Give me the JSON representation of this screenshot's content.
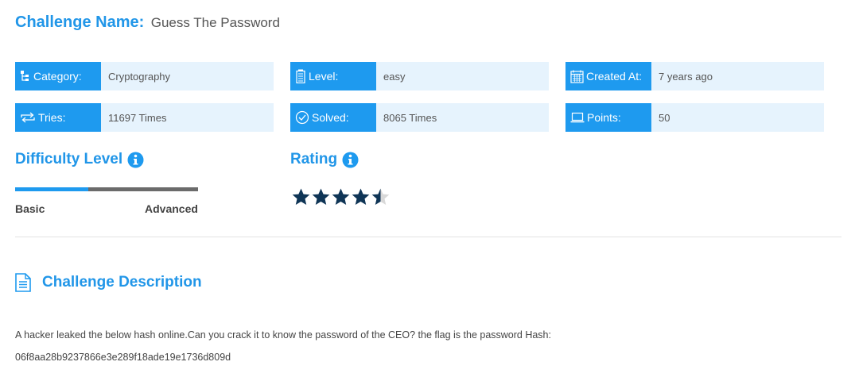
{
  "challenge": {
    "name_label": "Challenge Name:",
    "name": "Guess The Password"
  },
  "info": {
    "category": {
      "label": "Category:",
      "value": "Cryptography",
      "icon": "tree-icon"
    },
    "level": {
      "label": "Level:",
      "value": "easy",
      "icon": "battery-icon"
    },
    "created": {
      "label": "Created At:",
      "value": "7 years ago",
      "icon": "calendar-icon"
    },
    "tries": {
      "label": "Tries:",
      "value": "11697 Times",
      "icon": "repeat-icon"
    },
    "solved": {
      "label": "Solved:",
      "value": "8065 Times",
      "icon": "check-circle-icon"
    },
    "points": {
      "label": "Points:",
      "value": "50",
      "icon": "laptop-icon"
    }
  },
  "difficulty": {
    "title": "Difficulty Level",
    "level_fraction": 0.4,
    "min_label": "Basic",
    "max_label": "Advanced"
  },
  "rating": {
    "title": "Rating",
    "value": 4.5,
    "max": 5
  },
  "description": {
    "title": "Challenge Description",
    "text": "A hacker leaked the below hash online.Can you crack it to know the password of the CEO? the flag is the password Hash:",
    "hash": "06f8aa28b9237866e3e289f18ade19e1736d809d"
  },
  "colors": {
    "accent": "#1e9aef",
    "accent_light": "#e6f3fd",
    "star": "#0f3556",
    "star_empty": "#d8d8d8"
  }
}
